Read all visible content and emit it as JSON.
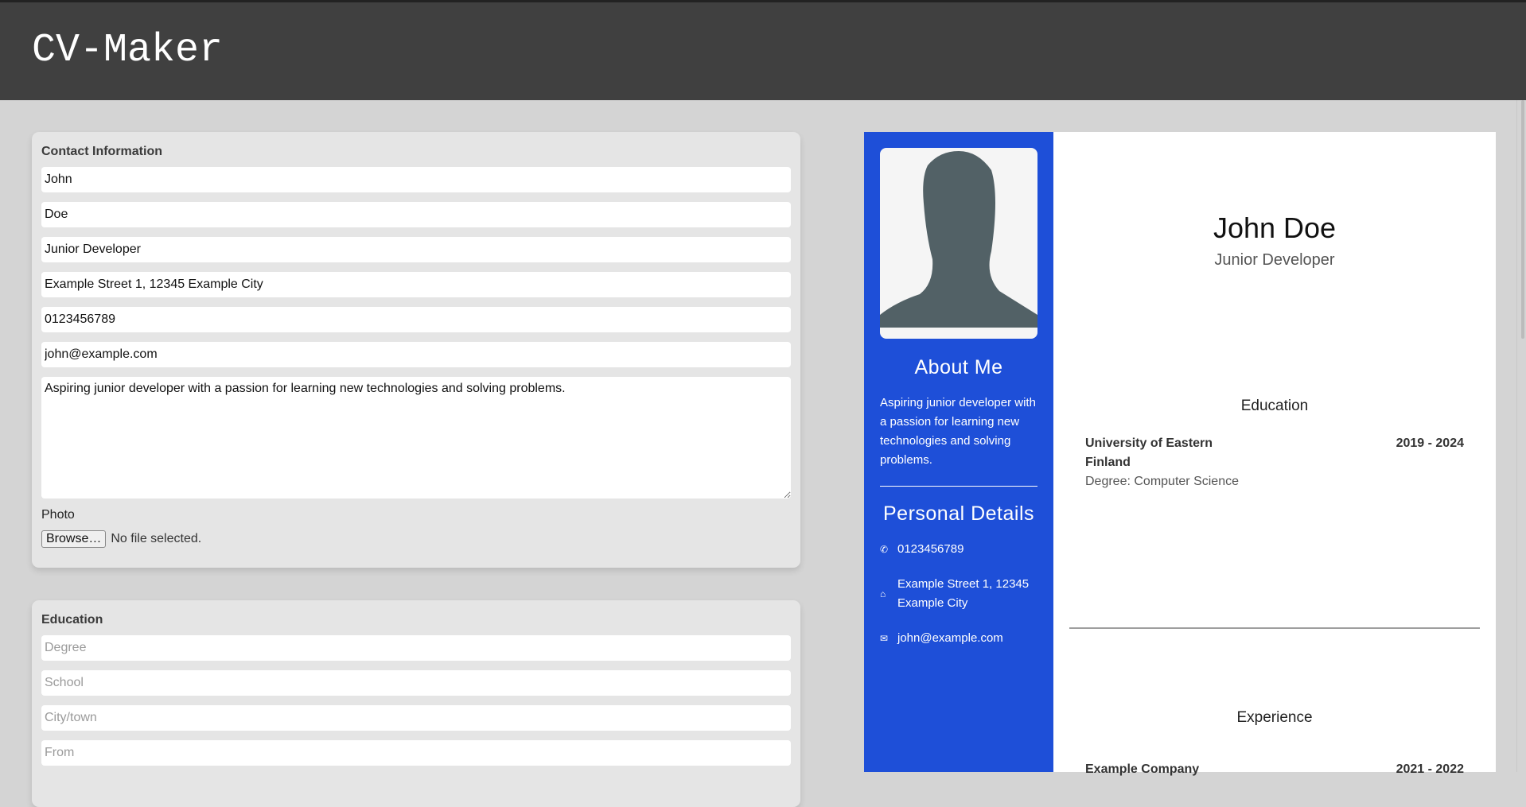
{
  "app": {
    "title": "CV-Maker"
  },
  "contact_form": {
    "heading": "Contact Information",
    "first_name": "John",
    "last_name": "Doe",
    "job_title": "Junior Developer",
    "address": "Example Street 1, 12345 Example City",
    "phone": "0123456789",
    "email": "john@example.com",
    "about": "Aspiring junior developer with a passion for learning new technologies and solving problems.",
    "photo_label": "Photo",
    "browse_label": "Browse…",
    "file_status": "No file selected."
  },
  "education_form": {
    "heading": "Education",
    "placeholders": {
      "degree": "Degree",
      "school": "School",
      "city": "City/town",
      "from": "From"
    }
  },
  "cv": {
    "accent_color": "#1e4fd8",
    "photo_icon": "person-silhouette",
    "about_title": "About Me",
    "about_text": "Aspiring junior developer with a passion for learning new technologies and solving problems.",
    "details_title": "Personal Details",
    "phone": "0123456789",
    "address": "Example Street 1, 12345 Example City",
    "email": "john@example.com",
    "name": "John Doe",
    "job_title": "Junior Developer",
    "education_title": "Education",
    "education": [
      {
        "school": "University of Eastern Finland",
        "dates": "2019 - 2024",
        "degree": "Degree: Computer Science"
      }
    ],
    "experience_title": "Experience",
    "experience": [
      {
        "company": "Example Company",
        "dates": "2021 - 2022"
      }
    ]
  }
}
